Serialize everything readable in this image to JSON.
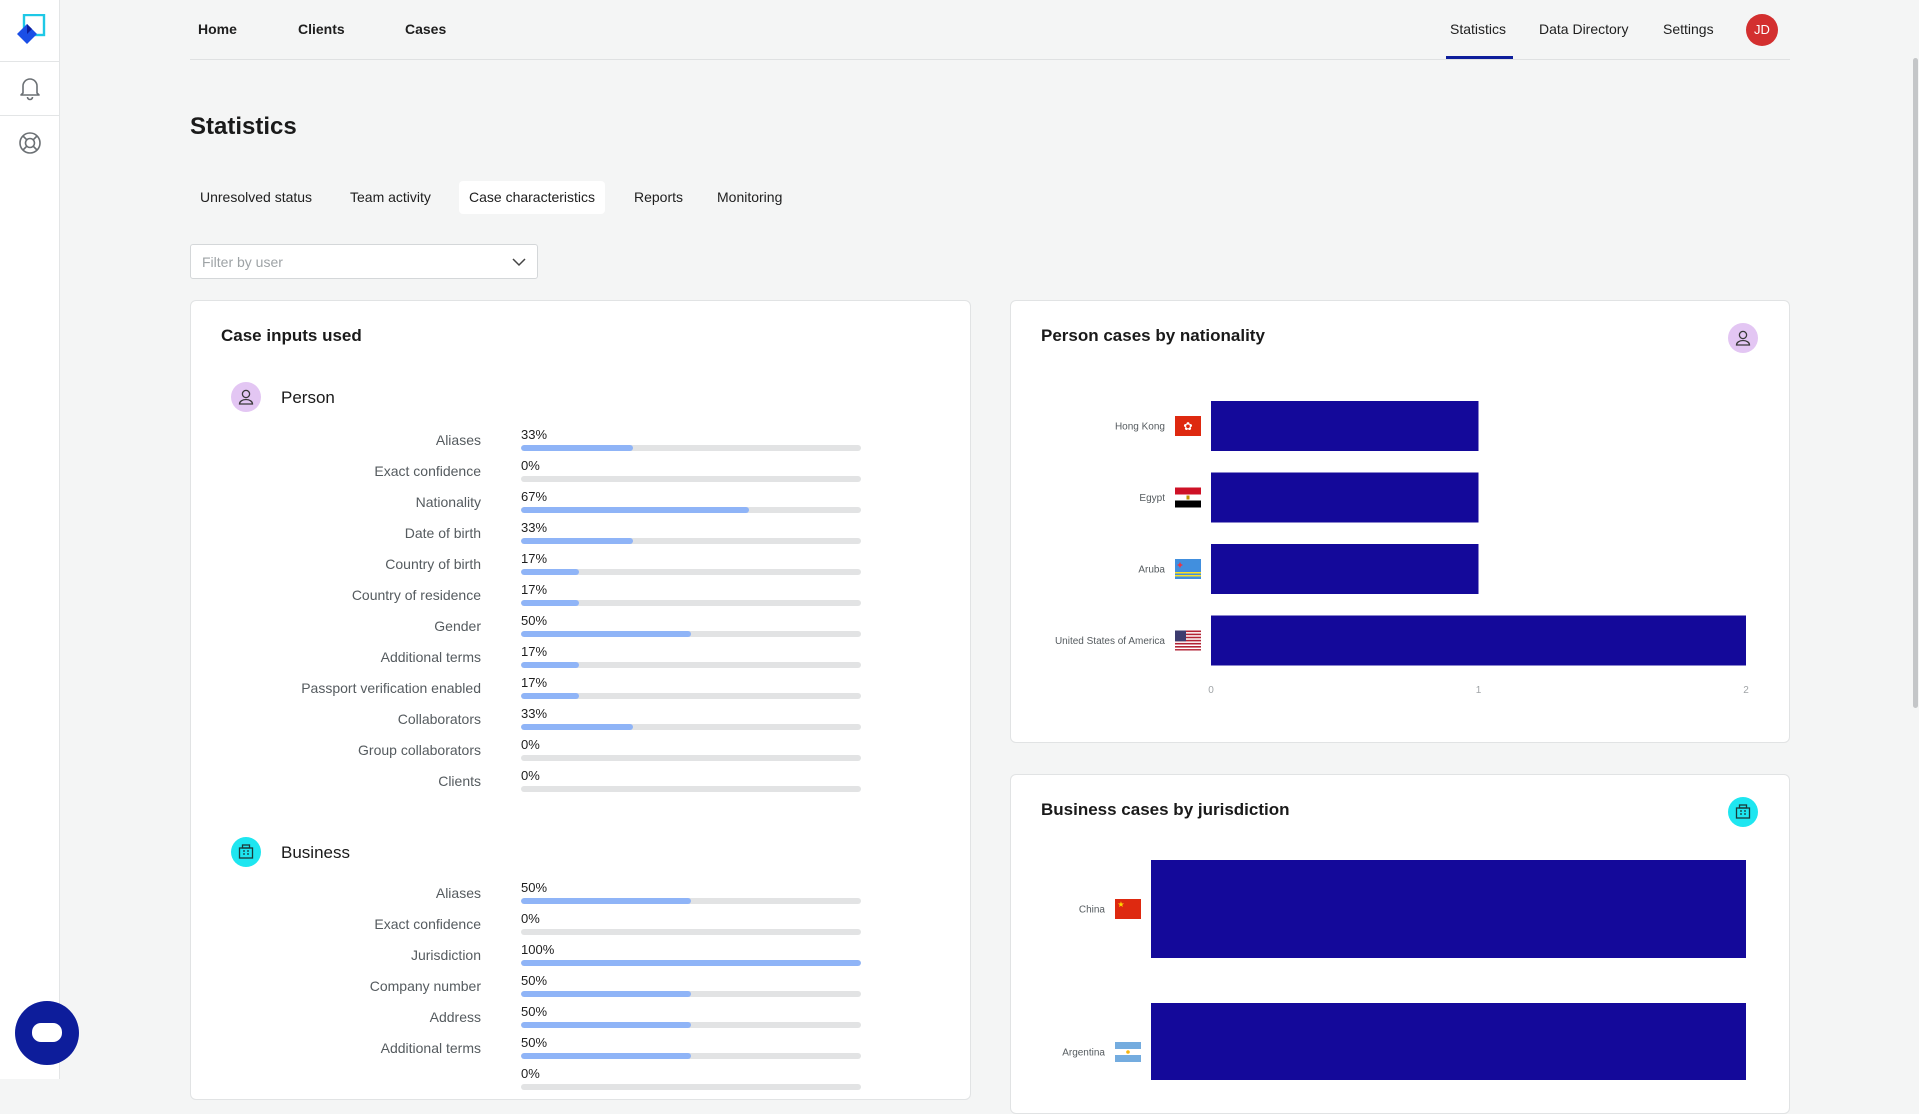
{
  "nav": {
    "left": [
      "Home",
      "Clients",
      "Cases"
    ],
    "right": [
      "Statistics",
      "Data Directory",
      "Settings"
    ],
    "active": "Statistics",
    "avatar_initials": "JD"
  },
  "page_title": "Statistics",
  "tabs": [
    "Unresolved status",
    "Team activity",
    "Case characteristics",
    "Reports",
    "Monitoring"
  ],
  "active_tab": "Case characteristics",
  "filter": {
    "placeholder": "Filter by user",
    "value": ""
  },
  "case_inputs": {
    "title": "Case inputs used",
    "person": {
      "label": "Person",
      "rows": [
        {
          "label": "Aliases",
          "pct": "33%",
          "value": 33
        },
        {
          "label": "Exact confidence",
          "pct": "0%",
          "value": 0
        },
        {
          "label": "Nationality",
          "pct": "67%",
          "value": 67
        },
        {
          "label": "Date of birth",
          "pct": "33%",
          "value": 33
        },
        {
          "label": "Country of birth",
          "pct": "17%",
          "value": 17
        },
        {
          "label": "Country of residence",
          "pct": "17%",
          "value": 17
        },
        {
          "label": "Gender",
          "pct": "50%",
          "value": 50
        },
        {
          "label": "Additional terms",
          "pct": "17%",
          "value": 17
        },
        {
          "label": "Passport verification enabled",
          "pct": "17%",
          "value": 17
        },
        {
          "label": "Collaborators",
          "pct": "33%",
          "value": 33
        },
        {
          "label": "Group collaborators",
          "pct": "0%",
          "value": 0
        },
        {
          "label": "Clients",
          "pct": "0%",
          "value": 0
        }
      ]
    },
    "business": {
      "label": "Business",
      "rows": [
        {
          "label": "Aliases",
          "pct": "50%",
          "value": 50
        },
        {
          "label": "Exact confidence",
          "pct": "0%",
          "value": 0
        },
        {
          "label": "Jurisdiction",
          "pct": "100%",
          "value": 100
        },
        {
          "label": "Company number",
          "pct": "50%",
          "value": 50
        },
        {
          "label": "Address",
          "pct": "50%",
          "value": 50
        },
        {
          "label": "Additional terms",
          "pct": "50%",
          "value": 50
        },
        {
          "label": "",
          "pct": "0%",
          "value": 0
        }
      ]
    }
  },
  "chart_data": [
    {
      "type": "bar",
      "orientation": "horizontal",
      "title": "Person cases by nationality",
      "categories": [
        "Hong Kong",
        "Egypt",
        "Aruba",
        "United States of America"
      ],
      "values": [
        1,
        1,
        1,
        2
      ],
      "xlim": [
        0,
        2
      ],
      "xticks": [
        "0",
        "1",
        "2"
      ],
      "bar_color": "#14099a",
      "icon": "person-icon",
      "icon_color": "#e3c6f3"
    },
    {
      "type": "bar",
      "orientation": "horizontal",
      "title": "Business cases by jurisdiction",
      "categories": [
        "China",
        "Argentina"
      ],
      "values": [
        1,
        1
      ],
      "bar_color": "#14099a",
      "icon": "building-icon",
      "icon_color": "#1ee6f0"
    }
  ],
  "colors": {
    "accent": "#0d1d9b",
    "bar_fill": "#8fb4f7",
    "bar_track": "#e2e3e4",
    "avatar": "#d32f2f",
    "person_icon_bg": "#e3c6f3",
    "business_icon_bg": "#1ee6f0"
  }
}
